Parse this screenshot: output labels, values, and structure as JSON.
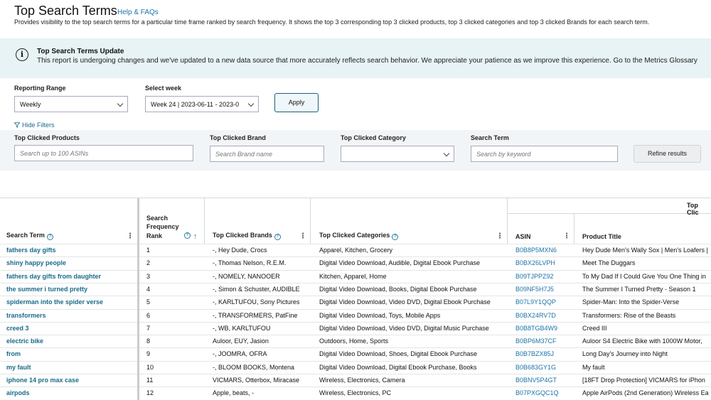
{
  "header": {
    "title": "Top Search Terms",
    "help_link": "Help & FAQs",
    "subtitle": "Provides visibility to the top search terms for a particular time frame ranked by search frequency. It shows the top 3 corresponding top 3 clicked products, top 3 clicked categories and top 3 clicked Brands for each search term."
  },
  "banner": {
    "icon": "info-icon",
    "title": "Top Search Terms Update",
    "text": "This report is undergoing changes and we've updated to a new data source that more accurately reflects search behavior. We appreciate your patience as we improve this experience. Go to the Metrics Glossary"
  },
  "controls": {
    "reporting_range_label": "Reporting Range",
    "reporting_range_value": "Weekly",
    "select_week_label": "Select week",
    "select_week_value": "Week 24 | 2023-06-11 - 2023-0",
    "apply_label": "Apply",
    "hide_filters_label": "Hide Filters"
  },
  "filters": {
    "products_label": "Top Clicked Products",
    "products_placeholder": "Search up to 100 ASINs",
    "brand_label": "Top Clicked Brand",
    "brand_placeholder": "Search Brand name",
    "category_label": "Top Clicked Category",
    "category_value": "",
    "term_label": "Search Term",
    "term_placeholder": "Search by keyword",
    "refine_label": "Refine results"
  },
  "table": {
    "group_header": "Top Clic",
    "columns": {
      "search_term": "Search Term",
      "rank_line1": "Search",
      "rank_line2": "Frequency",
      "rank_line3": "Rank",
      "brands": "Top Clicked Brands",
      "categories": "Top Clicked Categories",
      "asin": "ASIN",
      "product_title": "Product Title"
    },
    "rows": [
      {
        "term": "fathers day gifts",
        "rank": "1",
        "brands": "-, Hey Dude, Crocs",
        "categories": "Apparel, Kitchen, Grocery",
        "asin": "B0B8P5MXN6",
        "title": "Hey Dude Men's Wally Sox | Men's Loafers |"
      },
      {
        "term": "shiny happy people",
        "rank": "2",
        "brands": "-, Thomas Nelson, R.E.M.",
        "categories": "Digital Video Download, Audible, Digital Ebook Purchase",
        "asin": "B0BX26LVPH",
        "title": "Meet The Duggars"
      },
      {
        "term": "fathers day gifts from daughter",
        "rank": "3",
        "brands": "-, NOMELY, NANOOER",
        "categories": "Kitchen, Apparel, Home",
        "asin": "B09TJPPZ92",
        "title": "To My Dad If I Could Give You One Thing in"
      },
      {
        "term": "the summer i turned pretty",
        "rank": "4",
        "brands": "-, Simon & Schuster, AUDIBLE",
        "categories": "Digital Video Download, Books, Digital Ebook Purchase",
        "asin": "B09NF5H7J5",
        "title": "The Summer I Turned Pretty - Season 1"
      },
      {
        "term": "spiderman into the spider verse",
        "rank": "5",
        "brands": "-, KARLTUFOU, Sony Pictures",
        "categories": "Digital Video Download, Video DVD, Digital Ebook Purchase",
        "asin": "B07L9Y1QQP",
        "title": "Spider-Man: Into the Spider-Verse"
      },
      {
        "term": "transformers",
        "rank": "6",
        "brands": "-, TRANSFORMERS, PatFine",
        "categories": "Digital Video Download, Toys, Mobile Apps",
        "asin": "B0BX24RV7D",
        "title": "Transformers: Rise of the Beasts"
      },
      {
        "term": "creed 3",
        "rank": "7",
        "brands": "-, WB, KARLTUFOU",
        "categories": "Digital Video Download, Video DVD, Digital Music Purchase",
        "asin": "B0B8TGB4W9",
        "title": "Creed III"
      },
      {
        "term": "electric bike",
        "rank": "8",
        "brands": "Auloor, EUY, Jasion",
        "categories": "Outdoors, Home, Sports",
        "asin": "B0BP6M37CF",
        "title": "Auloor S4 Electric Bike with 1000W Motor,"
      },
      {
        "term": "from",
        "rank": "9",
        "brands": "-, JOOMRA, OFRA",
        "categories": "Digital Video Download, Shoes, Digital Ebook Purchase",
        "asin": "B0B7BZX85J",
        "title": "Long Day's Journey into Night"
      },
      {
        "term": "my fault",
        "rank": "10",
        "brands": "-, BLOOM BOOKS, Montena",
        "categories": "Digital Video Download, Digital Ebook Purchase, Books",
        "asin": "B0B683GY1G",
        "title": "My fault"
      },
      {
        "term": "iphone 14 pro max case",
        "rank": "11",
        "brands": "VICMARS, Otterbox, Miracase",
        "categories": "Wireless, Electronics, Camera",
        "asin": "B0BNV5P4GT",
        "title": "[18FT Drop Protection] VICMARS for iPhon"
      },
      {
        "term": "airpods",
        "rank": "12",
        "brands": "Apple, beats, -",
        "categories": "Wireless, Electronics, PC",
        "asin": "B07PXGQC1Q",
        "title": "Apple AirPods (2nd Generation) Wireless Ea"
      }
    ]
  }
}
